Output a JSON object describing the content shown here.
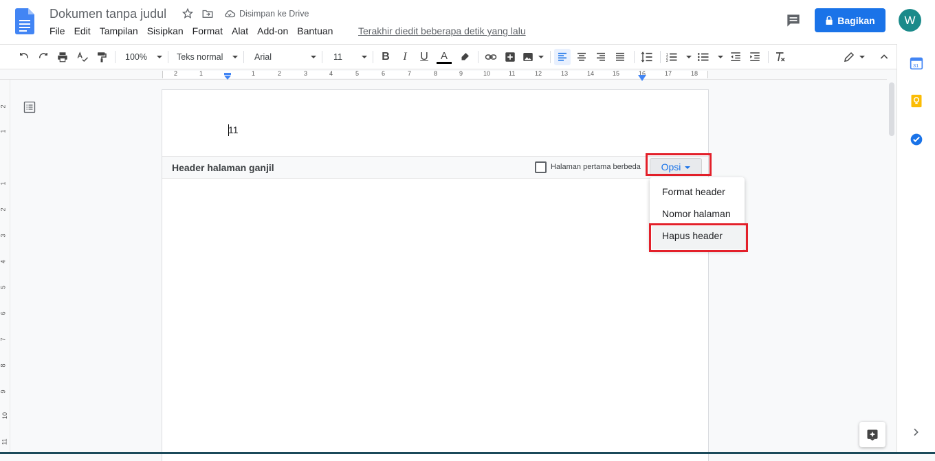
{
  "title_bar": {
    "doc_title": "Dokumen tanpa judul",
    "saved_status": "Disimpan ke Drive",
    "last_edit": "Terakhir diedit beberapa detik yang lalu",
    "share_label": "Bagikan",
    "avatar_letter": "W"
  },
  "menu": [
    "File",
    "Edit",
    "Tampilan",
    "Sisipkan",
    "Format",
    "Alat",
    "Add-on",
    "Bantuan"
  ],
  "toolbar": {
    "zoom": "100%",
    "style": "Teks normal",
    "font": "Arial",
    "font_size": "11"
  },
  "ruler": {
    "labels": [
      "2",
      "1",
      "1",
      "2",
      "3",
      "4",
      "5",
      "6",
      "7",
      "8",
      "9",
      "10",
      "11",
      "12",
      "13",
      "14",
      "15",
      "16",
      "17",
      "18"
    ]
  },
  "vertical_ruler": {
    "labels": [
      "2",
      "1",
      "1",
      "2",
      "3",
      "4",
      "5",
      "6",
      "7",
      "8",
      "9",
      "10",
      "11"
    ]
  },
  "document": {
    "header_content": "11",
    "header_label": "Header halaman ganjil",
    "different_first_page_label": "Halaman pertama berbeda",
    "different_first_page_checked": false,
    "options_label": "Opsi"
  },
  "options_menu": {
    "items": [
      "Format header",
      "Nomor halaman",
      "Hapus header"
    ],
    "highlighted": "Hapus header"
  },
  "colors": {
    "accent": "#1a73e8",
    "highlight_box": "#e3202a",
    "avatar": "#1a8a8a"
  }
}
